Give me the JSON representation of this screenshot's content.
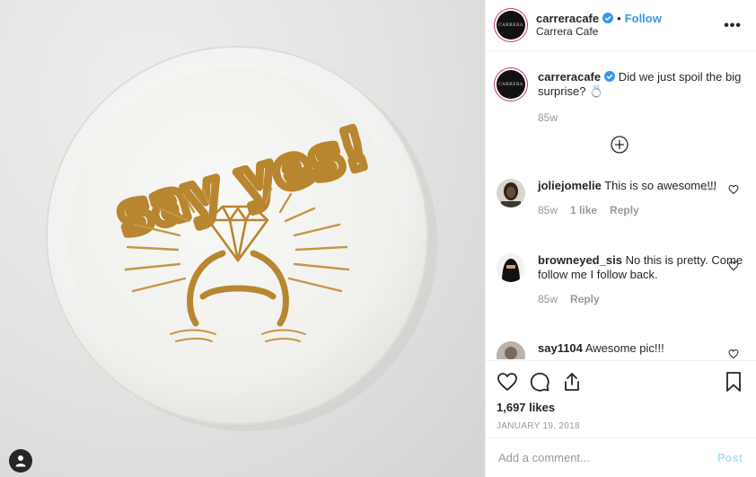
{
  "post": {
    "image_text": "say yes!",
    "user_tag_icon": "person-icon"
  },
  "header": {
    "username": "carreracafe",
    "separator": "•",
    "follow_label": "Follow",
    "location": "Carrera Cafe",
    "more_label": "•••",
    "verified_icon": "verified-badge-icon",
    "avatar_text": "CARRERA"
  },
  "caption": {
    "username": "carreracafe",
    "text": "Did we just spoil the big surprise? 💍",
    "time": "85w"
  },
  "load_more_icon": "plus-circle-icon",
  "comments": [
    {
      "username": "joliejomelie",
      "text": "This is so awesome!!!",
      "time": "85w",
      "likes": "1 like",
      "reply": "Reply",
      "more": "•••"
    },
    {
      "username": "browneyed_sis",
      "text": "No this is pretty. Come follow me I follow back.",
      "time": "85w",
      "reply": "Reply"
    },
    {
      "username": "say1104",
      "text": "Awesome pic!!!"
    }
  ],
  "actions": {
    "icons": [
      "heart-icon",
      "comment-icon",
      "share-icon",
      "bookmark-icon"
    ],
    "likes": "1,697 likes",
    "date": "JANUARY 19, 2018"
  },
  "add_comment": {
    "placeholder": "Add a comment...",
    "post_label": "Post"
  },
  "colors": {
    "link_blue": "#3897f0",
    "post_disabled": "#b2dffc",
    "art_gold": "#b8862f",
    "foam": "#f6f6f4"
  }
}
